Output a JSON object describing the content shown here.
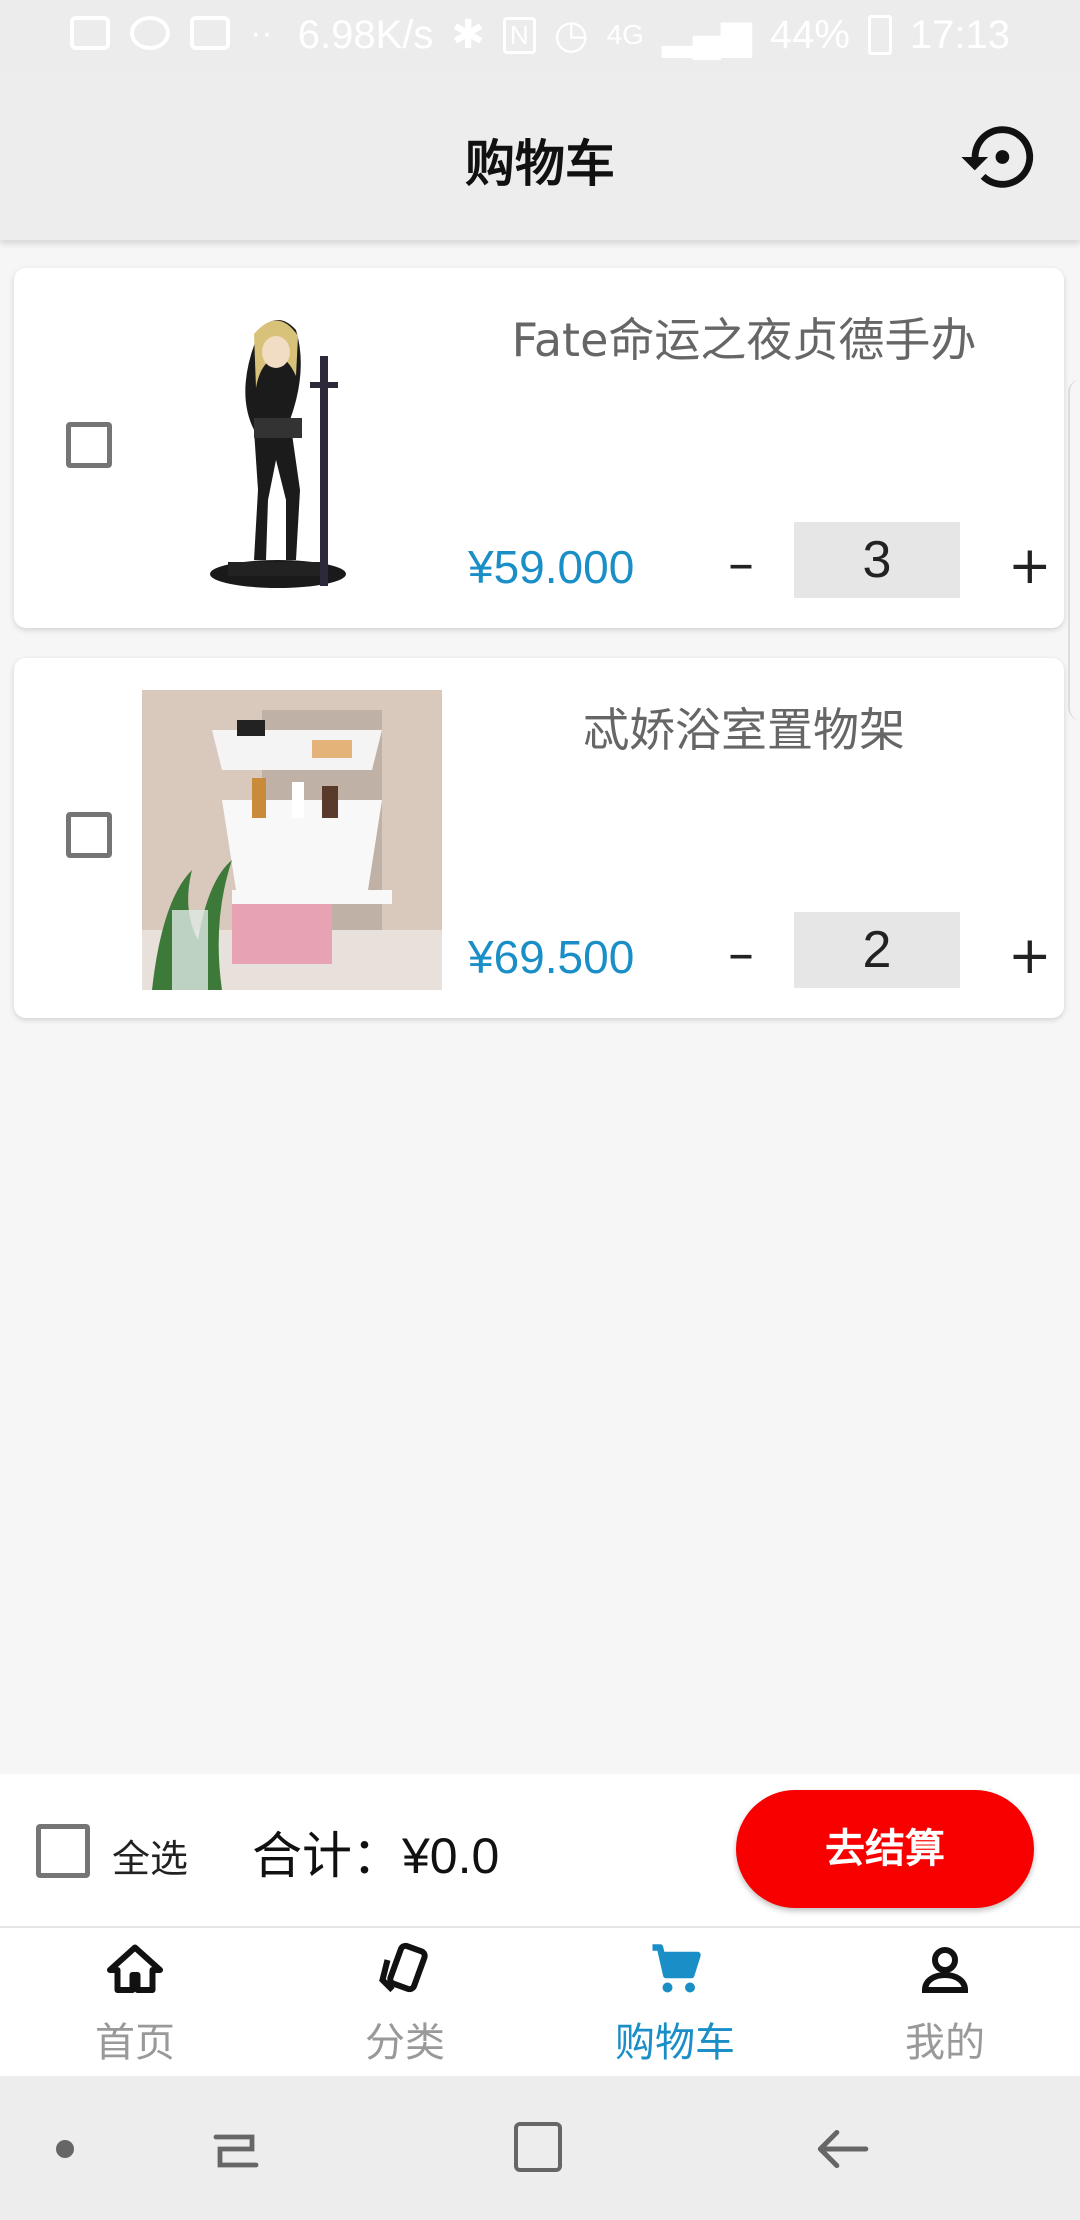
{
  "status_bar": {
    "speed": "6.98K/s",
    "network": "4G",
    "battery": "44%",
    "time": "17:13"
  },
  "app_bar": {
    "title": "购物车",
    "history_icon": "history-icon"
  },
  "cart": {
    "items": [
      {
        "name": "Fate命运之夜贞德手办",
        "price": "¥59.000",
        "quantity": "3",
        "minus_label": "–",
        "plus_label": "+",
        "image": "figure-image"
      },
      {
        "name": "忒娇浴室置物架",
        "price": "¥69.500",
        "quantity": "2",
        "minus_label": "–",
        "plus_label": "+",
        "image": "bathroom-shelf-image"
      }
    ]
  },
  "checkout": {
    "select_all_label": "全选",
    "total_label": "合计：¥0.0",
    "button_label": "去结算"
  },
  "bottom_nav": {
    "items": [
      {
        "label": "首页",
        "icon": "home-icon"
      },
      {
        "label": "分类",
        "icon": "category-icon"
      },
      {
        "label": "购物车",
        "icon": "cart-icon"
      },
      {
        "label": "我的",
        "icon": "person-icon"
      }
    ],
    "active_index": 2
  },
  "colors": {
    "accent": "#1a8ec7",
    "checkout_button": "#f80000",
    "app_bar": "#ededed"
  }
}
